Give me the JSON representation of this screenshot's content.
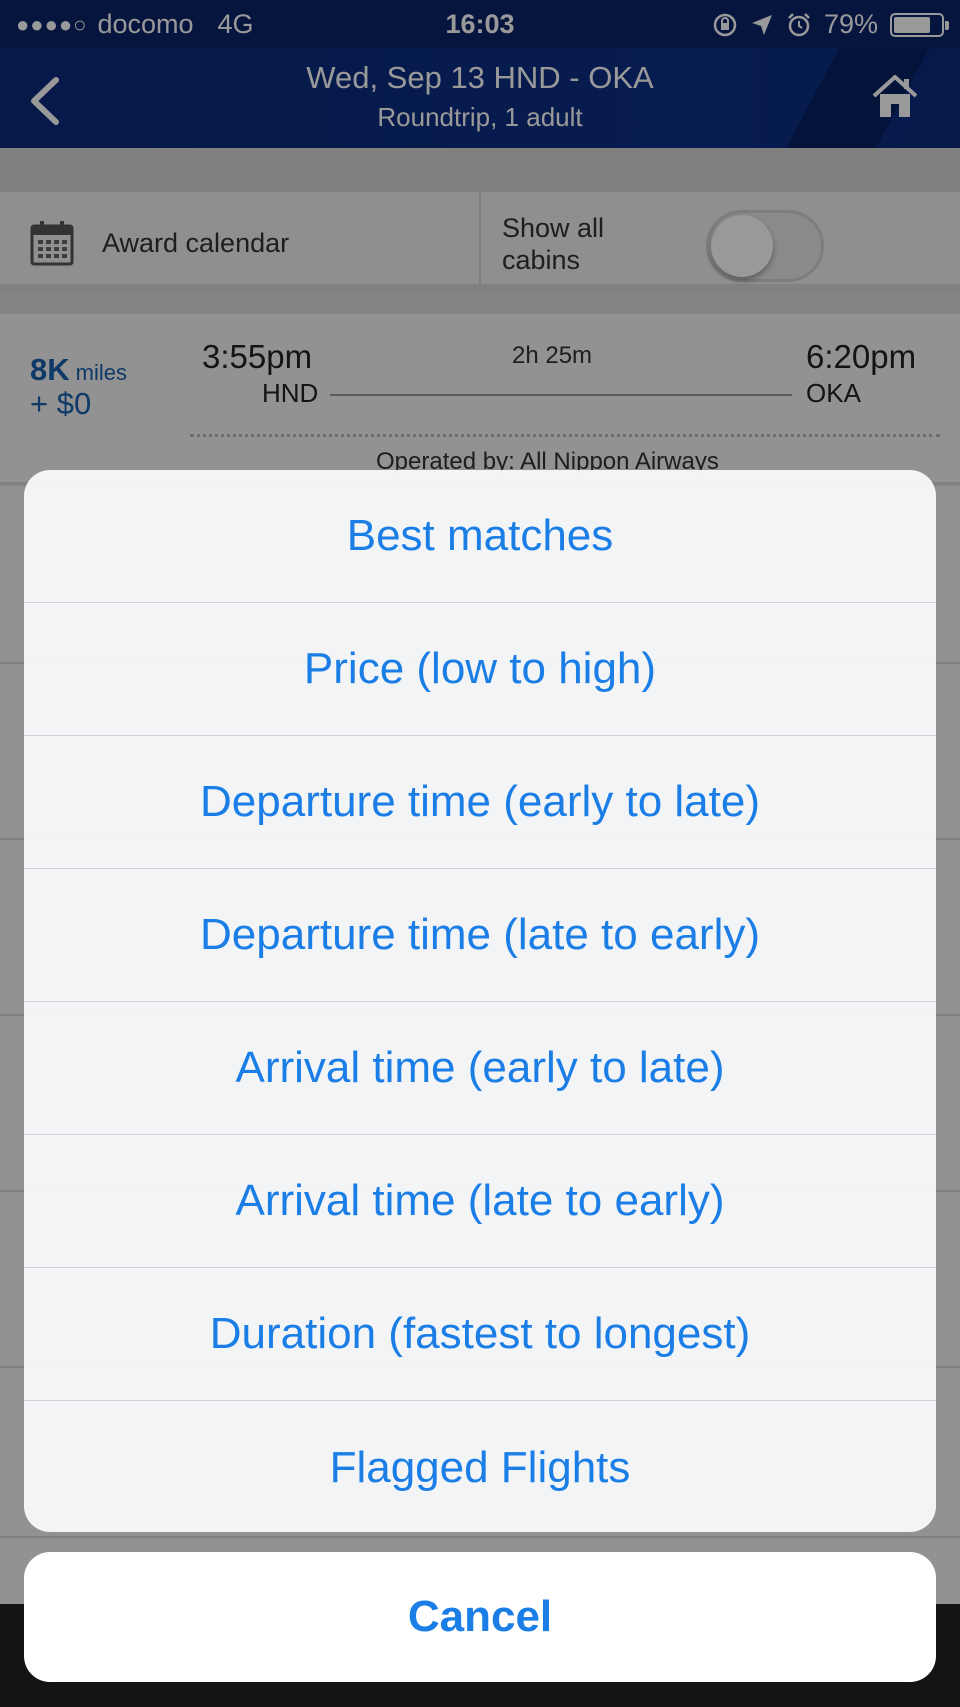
{
  "status_bar": {
    "signal": "●●●●○",
    "carrier": "docomo",
    "network": "4G",
    "time": "16:03",
    "battery": "79%",
    "battery_level": 0.79,
    "icons": [
      "orientation-lock-icon",
      "location-arrow-icon",
      "alarm-icon",
      "battery-icon"
    ]
  },
  "nav": {
    "title": "Wed, Sep 13 HND - OKA",
    "subtitle": "Roundtrip, 1 adult",
    "back_icon": "chevron-left-icon",
    "home_icon": "home-icon"
  },
  "filters": {
    "award_calendar": "Award calendar",
    "show_all_cabins": "Show all cabins",
    "show_all_cabins_on": false
  },
  "flight": {
    "miles": "8K",
    "miles_unit": "miles",
    "cash": "+ $0",
    "dep_time": "3:55pm",
    "dep_code": "HND",
    "duration": "2h 25m",
    "arr_time": "6:20pm",
    "arr_code": "OKA",
    "operated_by": "Operated by: All Nippon Airways"
  },
  "sort_sheet": {
    "options": [
      "Best matches",
      "Price (low to high)",
      "Departure time (early to late)",
      "Departure time (late to early)",
      "Arrival time (early to late)",
      "Arrival time (late to early)",
      "Duration (fastest to longest)",
      "Flagged Flights"
    ],
    "cancel": "Cancel"
  },
  "colors": {
    "nav_bg": "#0b2a7a",
    "action_blue": "#1a7ee6",
    "miles_blue": "#1a5faa"
  }
}
